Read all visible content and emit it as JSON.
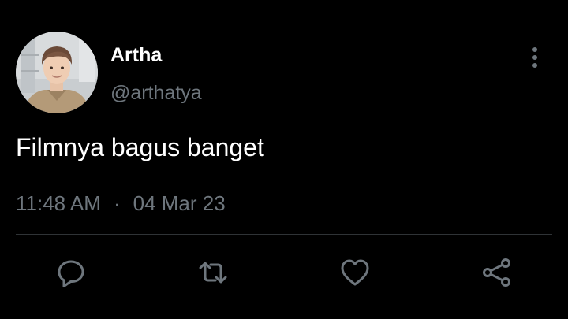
{
  "tweet": {
    "display_name": "Artha",
    "handle": "@arthatya",
    "text": "Filmnya bagus banget",
    "time": "11:48 AM",
    "separator": "·",
    "date": "04 Mar 23"
  },
  "actions": [
    {
      "icon": "reply-icon"
    },
    {
      "icon": "retweet-icon"
    },
    {
      "icon": "like-icon"
    },
    {
      "icon": "share-icon"
    }
  ],
  "colors": {
    "background": "#000000",
    "primary_text": "#ffffff",
    "secondary_text": "#6e767d",
    "divider": "#2f3336"
  }
}
